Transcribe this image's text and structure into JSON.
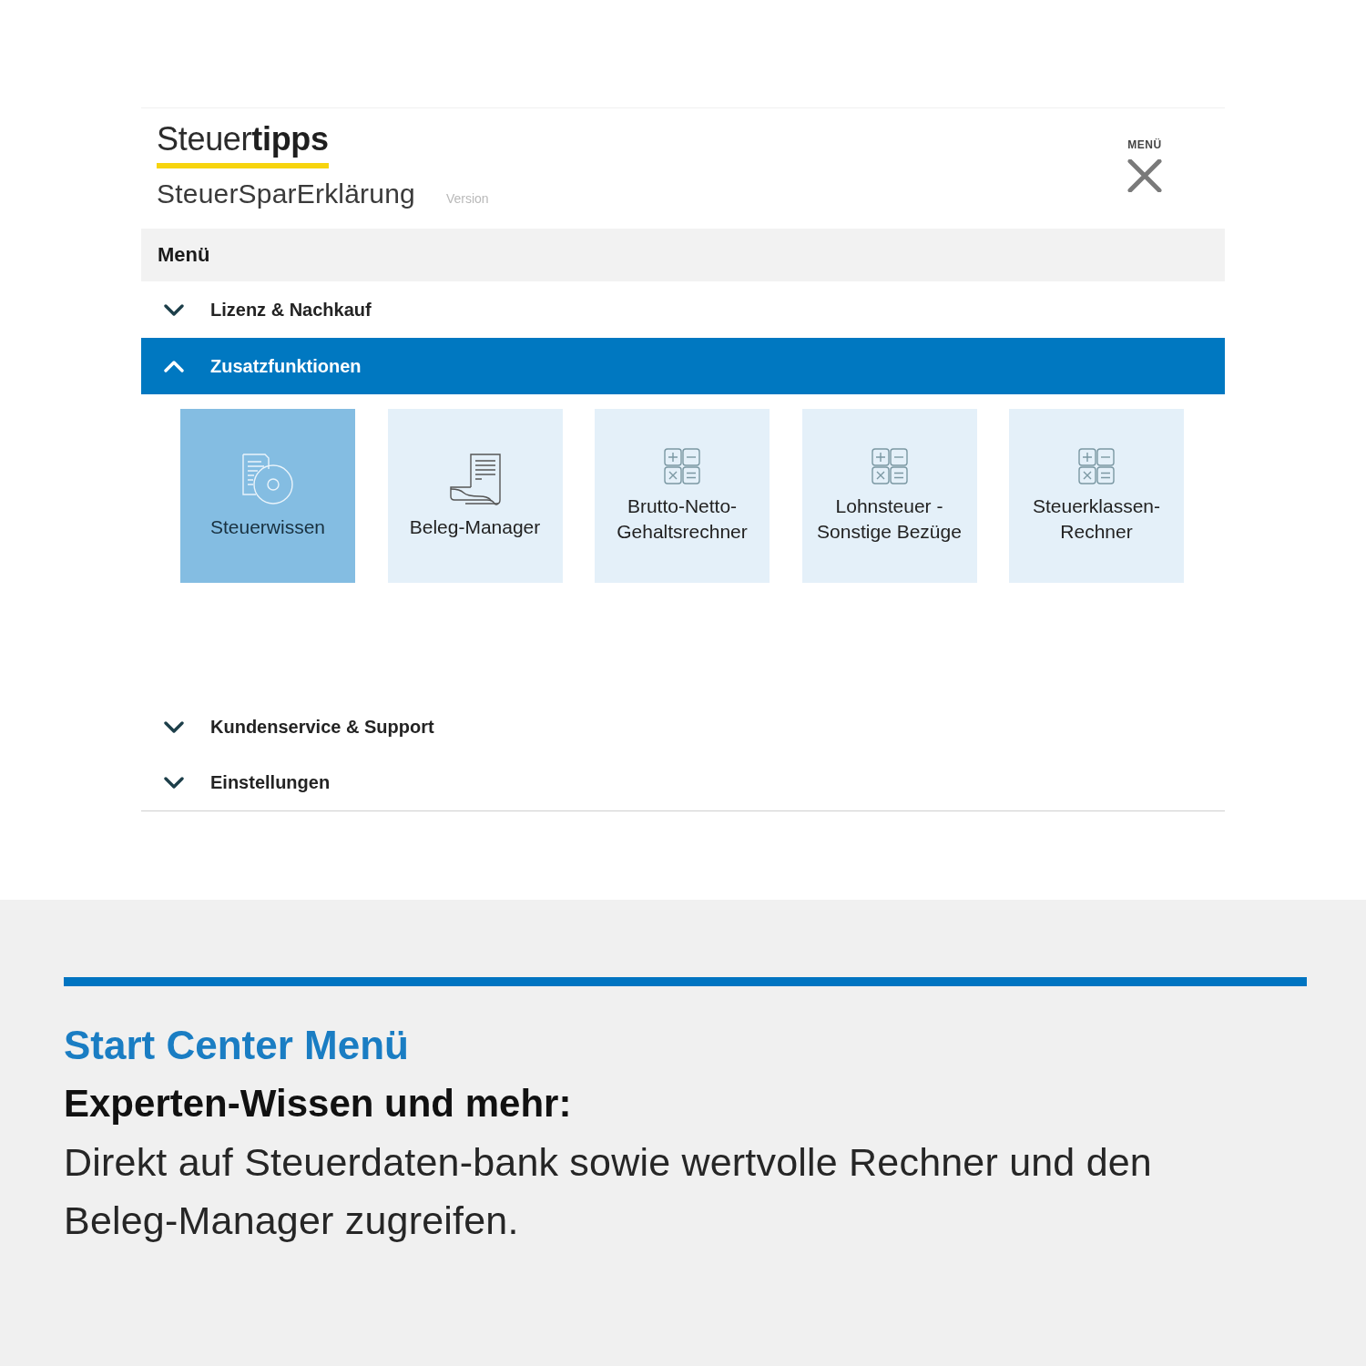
{
  "header": {
    "logo": "Steuer**tipps**",
    "product": "SteuerSparErklärung",
    "version_label": "Version",
    "menu_button": "MENÜ"
  },
  "menu": {
    "title": "Menü",
    "sections": [
      {
        "label": "Lizenz & Nachkauf",
        "expanded": false
      },
      {
        "label": "Zusatzfunktionen",
        "expanded": true,
        "tiles": [
          {
            "label": "Steuerwissen",
            "kind": "knowledge",
            "selected": true
          },
          {
            "label": "Beleg-Manager",
            "kind": "receipts",
            "selected": false
          },
          {
            "label": "Brutto-Netto-Gehaltsrechner",
            "kind": "calculator",
            "selected": false
          },
          {
            "label": "Lohnsteuer - Sonstige Bezüge",
            "kind": "calculator",
            "selected": false
          },
          {
            "label": "Steuerklassen-Rechner",
            "kind": "calculator",
            "selected": false
          }
        ]
      },
      {
        "label": "Kundenservice & Support",
        "expanded": false
      },
      {
        "label": "Einstellungen",
        "expanded": false
      }
    ]
  },
  "caption": {
    "title": "Start Center Menü",
    "subtitle": "Experten-Wissen und mehr:",
    "text": "Direkt auf Steuerdaten-bank sowie wertvolle Rechner und den Beleg-Manager zugreifen."
  }
}
